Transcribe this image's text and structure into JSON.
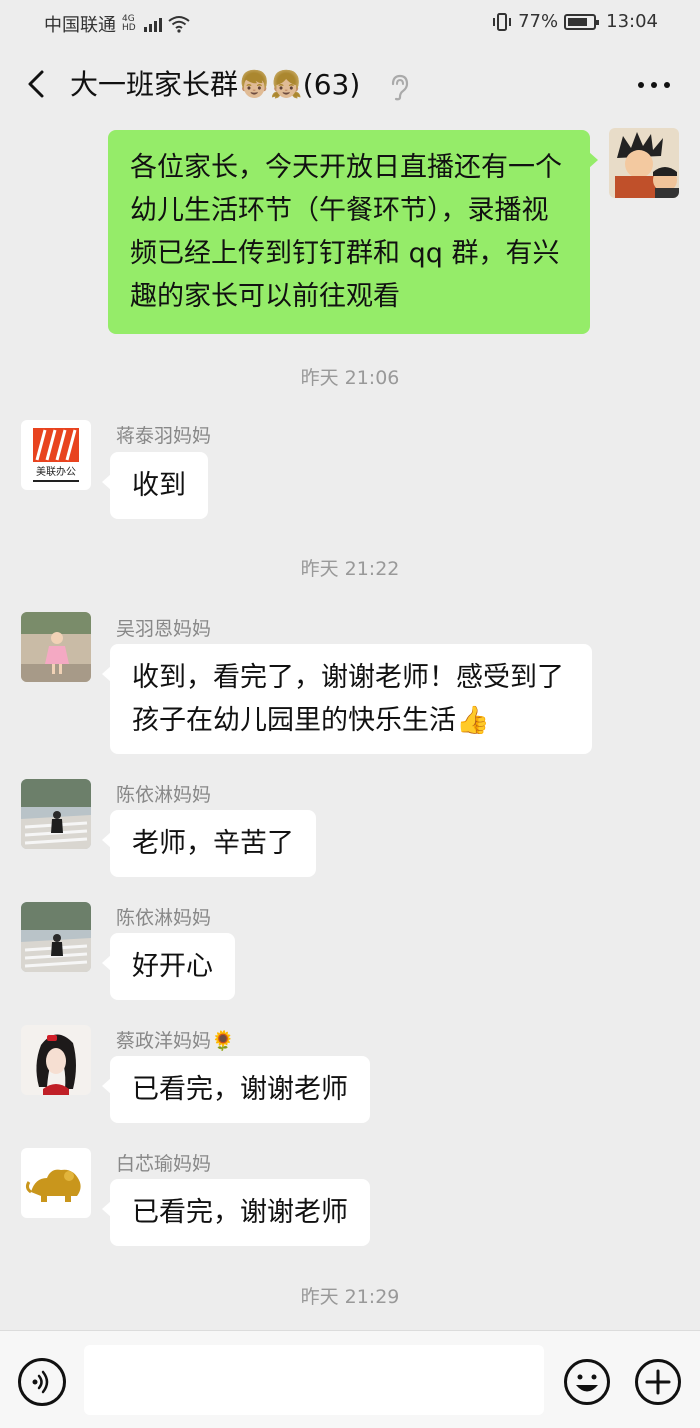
{
  "status_bar": {
    "carrier": "中国联通",
    "net_top": "4G",
    "net_bottom": "HD",
    "battery_text": "77%",
    "battery_level": 0.77,
    "clock": "13:04"
  },
  "header": {
    "title": "大一班家长群",
    "title_emoji": "👦🏼👧🏼",
    "member_count": "(63)"
  },
  "messages": [
    {
      "type": "self",
      "text": "各位家长，今天开放日直播还有一个幼儿生活环节（午餐环节），录播视频已经上传到钉钉群和 qq 群，有兴趣的家长可以前往观看",
      "avatar": "cartoon-avatar"
    },
    {
      "type": "time",
      "text": "昨天 21:06"
    },
    {
      "type": "other",
      "sender": "蒋泰羽妈妈",
      "text": "收到",
      "avatar": "meilian-logo-avatar",
      "avatar_label": "美联办公"
    },
    {
      "type": "time",
      "text": "昨天 21:22"
    },
    {
      "type": "other",
      "sender": "吴羽恩妈妈",
      "text": "收到，看完了，谢谢老师！感受到了孩子在幼儿园里的快乐生活👍",
      "avatar": "girl-photo-avatar"
    },
    {
      "type": "other",
      "sender": "陈依淋妈妈",
      "text": "老师，辛苦了",
      "avatar": "street-photo-avatar"
    },
    {
      "type": "other",
      "sender": "陈依淋妈妈",
      "text": "好开心",
      "avatar": "street-photo-avatar"
    },
    {
      "type": "other",
      "sender": "蔡政洋妈妈🌻",
      "text": "已看完，谢谢老师",
      "avatar": "woman-portrait-avatar"
    },
    {
      "type": "other",
      "sender": "白芯瑜妈妈",
      "text": "已看完，谢谢老师",
      "avatar": "golden-lion-avatar"
    },
    {
      "type": "time",
      "text": "昨天 21:29"
    }
  ],
  "input_bar": {
    "placeholder": ""
  },
  "colors": {
    "background": "#ededed",
    "self_bubble": "#95ec69",
    "other_bubble": "#ffffff",
    "meta_text": "#999999"
  }
}
